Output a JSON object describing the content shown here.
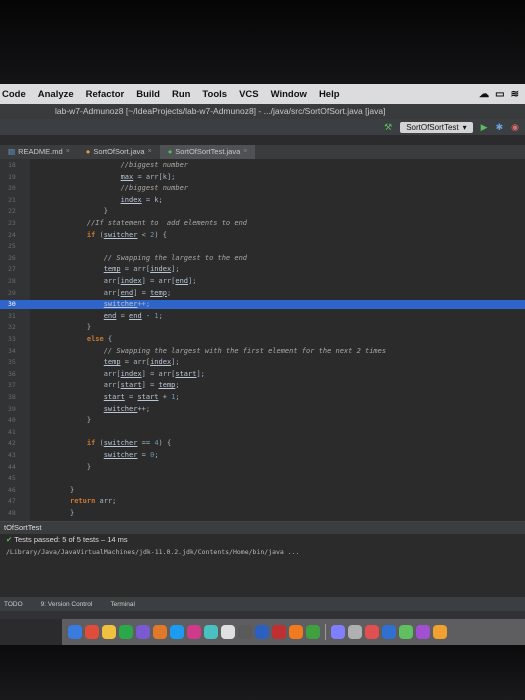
{
  "menu": {
    "items": [
      "Code",
      "Analyze",
      "Refactor",
      "Build",
      "Run",
      "Tools",
      "VCS",
      "Window",
      "Help"
    ]
  },
  "title_bar": "lab-w7-Admunoz8 [~/IdeaProjects/lab-w7-Admunoz8] - .../java/src/SortOfSort.java [java]",
  "toolbar": {
    "run_config": "SortOfSortTest"
  },
  "tabs": [
    {
      "label": "README.md"
    },
    {
      "label": "SortOfSort.java"
    },
    {
      "label": "SortOfSortTest.java"
    }
  ],
  "editor": {
    "lines": [
      {
        "n": "18",
        "text": "            //biggest number"
      },
      {
        "n": "19",
        "text": "            max = arr[k];"
      },
      {
        "n": "20",
        "text": "            //biggest number"
      },
      {
        "n": "21",
        "text": "            index = k;"
      },
      {
        "n": "22",
        "text": "        }"
      },
      {
        "n": "23",
        "text": "    //If statement to  add elements to end"
      },
      {
        "n": "24",
        "text": "    if (switcher < 2) {"
      },
      {
        "n": "25",
        "text": ""
      },
      {
        "n": "26",
        "text": "        // Swapping the largest to the end"
      },
      {
        "n": "27",
        "text": "        temp = arr[index];"
      },
      {
        "n": "28",
        "text": "        arr[index] = arr[end];"
      },
      {
        "n": "29",
        "text": "        arr[end] = temp;"
      },
      {
        "n": "30",
        "text": "        switcher++;"
      },
      {
        "n": "31",
        "text": "        end = end - 1;"
      },
      {
        "n": "32",
        "text": "    }"
      },
      {
        "n": "33",
        "text": "    else {"
      },
      {
        "n": "34",
        "text": "        // Swapping the largest with the first element for the next 2 times"
      },
      {
        "n": "35",
        "text": "        temp = arr[index];"
      },
      {
        "n": "36",
        "text": "        arr[index] = arr[start];"
      },
      {
        "n": "37",
        "text": "        arr[start] = temp;"
      },
      {
        "n": "38",
        "text": "        start = start + 1;"
      },
      {
        "n": "39",
        "text": "        switcher++;"
      },
      {
        "n": "40",
        "text": "    }"
      },
      {
        "n": "41",
        "text": ""
      },
      {
        "n": "42",
        "text": "    if (switcher == 4) {"
      },
      {
        "n": "43",
        "text": "        switcher = 0;"
      },
      {
        "n": "44",
        "text": "    }"
      },
      {
        "n": "45",
        "text": ""
      },
      {
        "n": "46",
        "text": "}"
      },
      {
        "n": "47",
        "text": "return arr;"
      },
      {
        "n": "48",
        "text": "}"
      }
    ]
  },
  "run_panel": {
    "title": "tOfSortTest",
    "status": "Tests passed: 5 of 5 tests – 14 ms",
    "command": "/Library/Java/JavaVirtualMachines/jdk-11.0.2.jdk/Contents/Home/bin/java ..."
  },
  "status_bar": {
    "todo": "TODO",
    "vcs": "9: Version Control",
    "terminal": "Terminal"
  },
  "colors": {
    "accent": "#2f65ca",
    "pass": "#5fb85f"
  }
}
